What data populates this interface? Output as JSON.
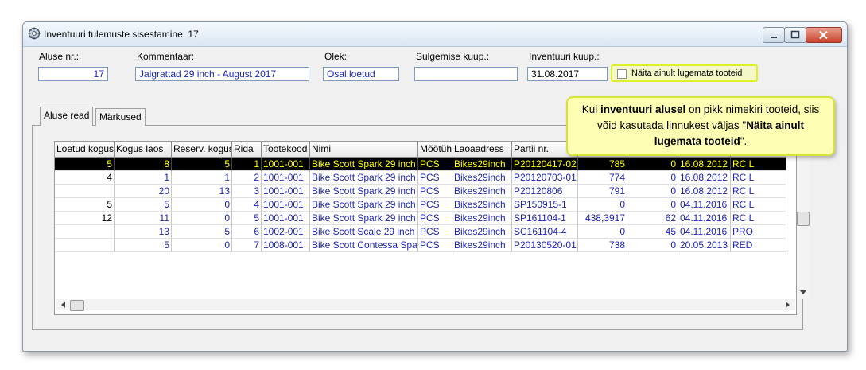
{
  "window": {
    "title": "Inventuuri tulemuste sisestamine: 17",
    "minimize_icon": "minimize-icon",
    "maximize_icon": "maximize-icon",
    "close_icon": "close-icon"
  },
  "header": {
    "base_no": {
      "label": "Aluse nr.:",
      "value": "17"
    },
    "comment": {
      "label": "Kommentaar:",
      "value": "Jalgrattad 29 inch - August 2017"
    },
    "status": {
      "label": "Olek:",
      "value": "Osal.loetud"
    },
    "closing_date": {
      "label": "Sulgemise kuup.:",
      "value": ""
    },
    "inventory_date": {
      "label": "Inventuuri kuup.:",
      "value": "31.08.2017"
    },
    "show_unread": {
      "label": "Näita ainult lugemata tooteid",
      "checked": false
    }
  },
  "tabs": [
    {
      "label": "Aluse read",
      "active": true
    },
    {
      "label": "Märkused",
      "active": false
    }
  ],
  "grid": {
    "columns": [
      "Loetud kogus",
      "Kogus laos",
      "Reserv. kogus",
      "Rida",
      "Tootekood",
      "Nimi",
      "Mõõtühik",
      "Laoaadress",
      "Partii nr.",
      "",
      "",
      "",
      ""
    ],
    "rows": [
      [
        "5",
        "8",
        "5",
        "1",
        "1001-001",
        "Bike Scott Spark 29 inch",
        "PCS",
        "Bikes29inch",
        "P20120417-02",
        "785",
        "0",
        "16.08.2012",
        "RC L"
      ],
      [
        "4",
        "1",
        "1",
        "2",
        "1001-001",
        "Bike Scott Spark 29 inch",
        "PCS",
        "Bikes29inch",
        "P20120703-01",
        "774",
        "0",
        "16.08.2012",
        "RC L"
      ],
      [
        "",
        "20",
        "13",
        "3",
        "1001-001",
        "Bike Scott Spark 29 inch",
        "PCS",
        "Bikes29inch",
        "P20120806",
        "791",
        "0",
        "16.08.2012",
        "RC L"
      ],
      [
        "5",
        "5",
        "0",
        "4",
        "1001-001",
        "Bike Scott Spark 29 inch",
        "PCS",
        "Bikes29inch",
        "SP150915-1",
        "0",
        "0",
        "04.11.2016",
        "RC L"
      ],
      [
        "12",
        "11",
        "0",
        "5",
        "1001-001",
        "Bike Scott Spark 29 inch",
        "PCS",
        "Bikes29inch",
        "SP161104-1",
        "438,3917",
        "62",
        "04.11.2016",
        "RC L"
      ],
      [
        "",
        "13",
        "5",
        "6",
        "1002-001",
        "Bike Scott Scale 29 inch",
        "PCS",
        "Bikes29inch",
        "SC161104-4",
        "0",
        "45",
        "04.11.2016",
        "PRO"
      ],
      [
        "",
        "5",
        "0",
        "7",
        "1008-001",
        "Bike Scott Contessa Spark",
        "PCS",
        "Bikes29inch",
        "P20130520-01",
        "738",
        "0",
        "20.05.2013",
        "RED"
      ]
    ],
    "selected_row": 0
  },
  "tooltip": {
    "part1": "Kui ",
    "bold1": "inventuuri alusel",
    "part2": " on pikk nimekiri tooteid, siis võid kasutada linnukest väljas ",
    "quote_open": "\"",
    "bold2": "Näita ainult lugemata tooteid",
    "quote_close": "\"."
  },
  "colors": {
    "value_text": "#1f26b8",
    "selected_row_bg": "#000000",
    "selected_row_text": "#ffff00",
    "tooltip_bg": "#ffffb3",
    "tooltip_border": "#d6e338"
  }
}
